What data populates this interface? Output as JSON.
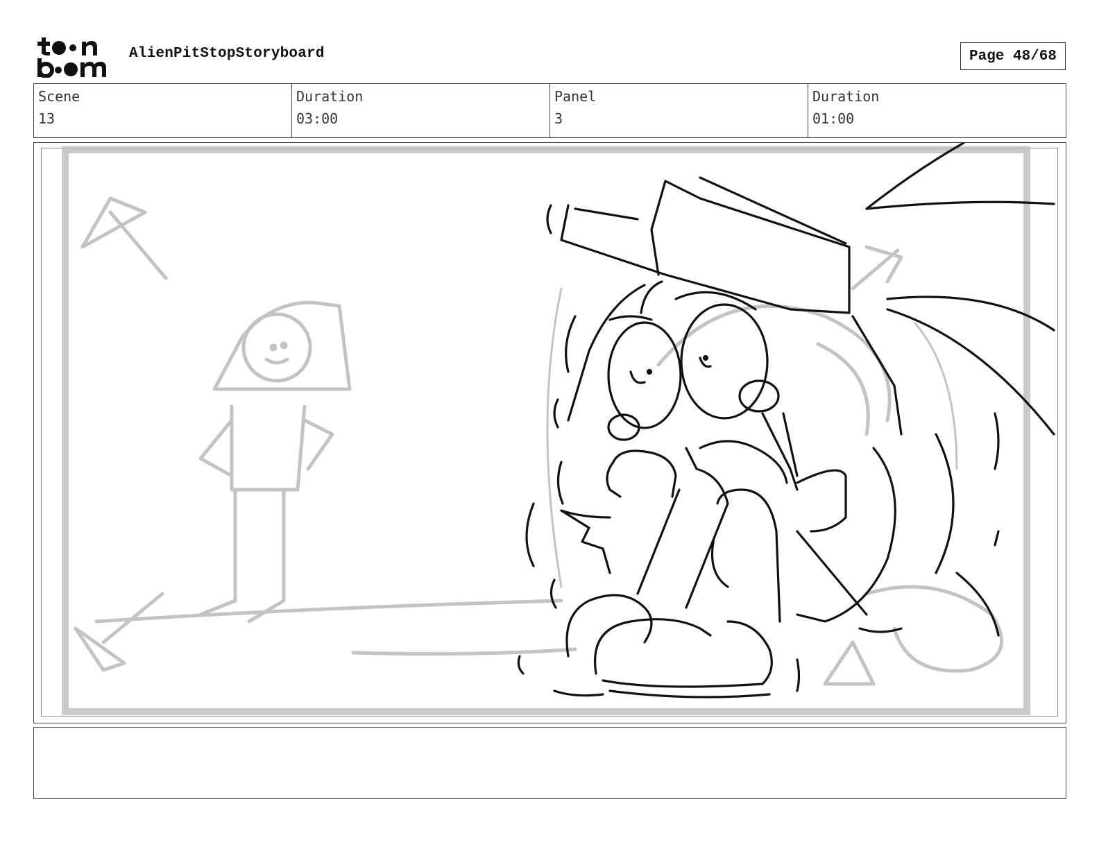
{
  "header": {
    "logo_text": "toon boom",
    "project_title": "AlienPitStopStoryboard",
    "page_indicator": "Page 48/68"
  },
  "info": {
    "scene_label": "Scene",
    "scene_value": "13",
    "scene_duration_label": "Duration",
    "scene_duration_value": "03:00",
    "panel_label": "Panel",
    "panel_value": "3",
    "panel_duration_label": "Duration",
    "panel_duration_value": "01:00"
  },
  "notes": {
    "text": ""
  }
}
